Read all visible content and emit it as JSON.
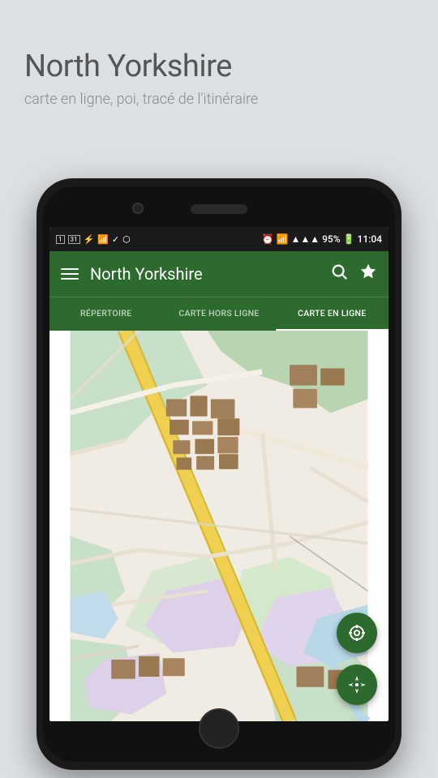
{
  "page": {
    "background_color": "#dde0e3"
  },
  "header": {
    "title": "North Yorkshire",
    "subtitle": "carte en ligne, poi, tracé de l'itinéraire"
  },
  "status_bar": {
    "left_icons": [
      "calendar-1",
      "calendar-31",
      "usb-icon",
      "signal-icon",
      "check-icon",
      "android-icon"
    ],
    "time": "11:04",
    "battery": "95%",
    "wifi": true
  },
  "toolbar": {
    "menu_icon": "☰",
    "title": "North Yorkshire",
    "search_icon": "search",
    "star_icon": "star"
  },
  "tabs": [
    {
      "label": "RÉPERTOIRE",
      "active": false
    },
    {
      "label": "CARTE HORS LIGNE",
      "active": false
    },
    {
      "label": "CARTE EN LIGNE",
      "active": true
    }
  ],
  "map": {
    "fab_locate": "⊙",
    "fab_move": "✛",
    "fab_navigate": "➤"
  }
}
